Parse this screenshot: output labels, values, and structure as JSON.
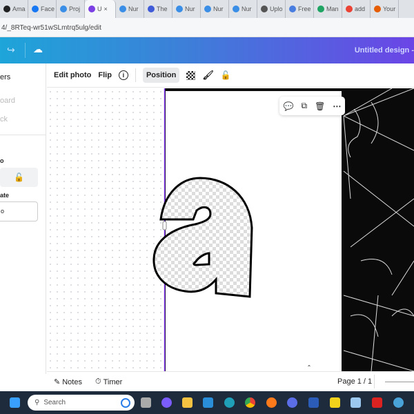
{
  "browser": {
    "tabs": [
      {
        "label": "Ama",
        "color": "#222"
      },
      {
        "label": "Face",
        "color": "#1877f2"
      },
      {
        "label": "Proj",
        "color": "#3a8ee6"
      },
      {
        "label": "U",
        "color": "#7b3fe4",
        "active": true
      },
      {
        "label": "Nur",
        "color": "#3a8ee6"
      },
      {
        "label": "The",
        "color": "#3f5bd8"
      },
      {
        "label": "Nur",
        "color": "#3a8ee6"
      },
      {
        "label": "Nur",
        "color": "#3a8ee6"
      },
      {
        "label": "Nur",
        "color": "#3a8ee6"
      },
      {
        "label": "Uplo",
        "color": "#555"
      },
      {
        "label": "Free",
        "color": "#4a7de0"
      },
      {
        "label": "Man",
        "color": "#1fa463"
      },
      {
        "label": "add",
        "color": "#ea4335"
      },
      {
        "label": "Your",
        "color": "#e65c00"
      }
    ],
    "url": "4/_8RTeq-wr51wSLmtrq5ulg/edit"
  },
  "header": {
    "title": "Untitled design -"
  },
  "left_panel": {
    "heading": "ers",
    "item1": "oard",
    "item2": "ck",
    "section1": "o",
    "section2": "ate",
    "field_value": "o"
  },
  "toolbar": {
    "edit_photo": "Edit photo",
    "flip": "Flip",
    "position": "Position"
  },
  "bottom": {
    "notes": "Notes",
    "timer": "Timer",
    "page": "Page 1 / 1"
  },
  "taskbar": {
    "search_placeholder": "Search"
  }
}
